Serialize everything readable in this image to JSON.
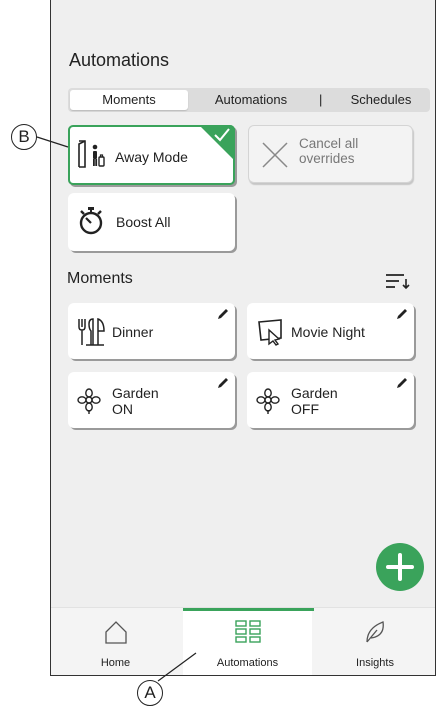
{
  "page": {
    "title": "Automations"
  },
  "segmented_control": {
    "tabs": [
      "Moments",
      "Automations",
      "Schedules"
    ],
    "divider": "|",
    "active": "Moments"
  },
  "quick_actions": {
    "away_mode": {
      "label": "Away Mode",
      "icon": "person-leaving-door-icon",
      "active": true,
      "badge_icon": "checkmark-icon"
    },
    "cancel_overrides": {
      "label": "Cancel all overrides",
      "icon": "close-x-icon",
      "disabled": true
    },
    "boost_all": {
      "label": "Boost All",
      "icon": "stopwatch-icon"
    }
  },
  "moments": {
    "section_title": "Moments",
    "sort_icon": "sort-icon",
    "items": [
      {
        "label": "Dinner",
        "icon": "cutlery-icon"
      },
      {
        "label": "Movie Night",
        "icon": "tv-icon"
      },
      {
        "label": "Garden ON",
        "icon": "flower-icon"
      },
      {
        "label": "Garden OFF",
        "icon": "flower-icon"
      }
    ]
  },
  "fab": {
    "label": "+",
    "icon": "plus-icon"
  },
  "nav": {
    "items": [
      {
        "label": "Home",
        "icon": "home-icon"
      },
      {
        "label": "Automations",
        "icon": "grid-icon",
        "active": true
      },
      {
        "label": "Insights",
        "icon": "leaf-icon"
      }
    ]
  },
  "callouts": {
    "a": "A",
    "b": "B"
  },
  "colors": {
    "accent": "#3aa35b",
    "background": "#efefef",
    "card": "#ffffff"
  }
}
